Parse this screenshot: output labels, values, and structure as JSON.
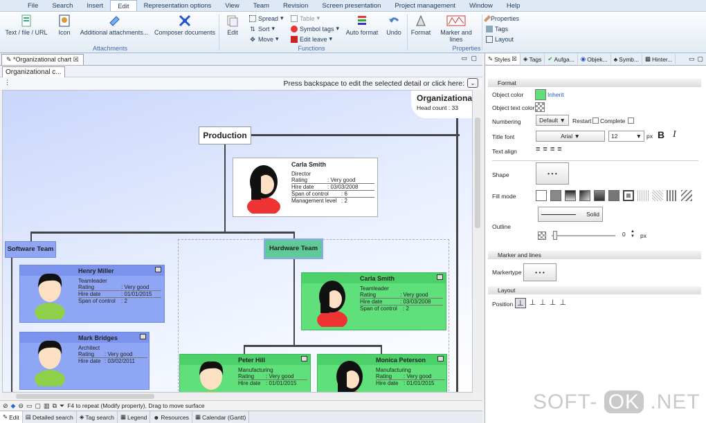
{
  "menu": [
    "File",
    "Search",
    "Insert",
    "Edit",
    "Representation options",
    "View",
    "Team",
    "Revision",
    "Screen presentation",
    "Project management",
    "Window",
    "Help"
  ],
  "ribbon": {
    "text_file_url": "Text / file / URL",
    "icon": "Icon",
    "additional": "Additional attachments...",
    "composer": "Composer documents",
    "attachments_group": "Attachments",
    "edit": "Edit",
    "spread": "Spread",
    "sort": "Sort",
    "move": "Move",
    "table": "Table",
    "symbol_tags": "Symbol tags",
    "edit_leave": "Edit leave",
    "auto_format": "Auto format",
    "undo": "Undo",
    "functions_group": "Functions",
    "format": "Format",
    "marker_lines": "Marker and lines",
    "properties": "Properties",
    "tags": "Tags",
    "layout": "Layout",
    "properties_group": "Properties"
  },
  "editor": {
    "tab": "*Organizational chart",
    "subtab": "Organizational c...",
    "hint": "Press backspace to edit the selected detail or click here:"
  },
  "chart": {
    "org_title": "Organizationa",
    "head_count": "Head count  : 33",
    "production": "Production",
    "software_team": "Software Team",
    "hardware_team": "Hardware Team",
    "carla_top": {
      "name": "Carla Smith",
      "role": "Director",
      "rating_l": "Rating",
      "rating": ": Very good",
      "hire_l": "Hire date",
      "hire": ": 03/03/2008",
      "span_l": "Span of control",
      "span": ": 6",
      "mgmt_l": "Management level",
      "mgmt": ": 2"
    },
    "henry": {
      "name": "Henry Miller",
      "role": "Teamleader",
      "rating_l": "Rating",
      "rating": ": Very good",
      "hire_l": "Hire date",
      "hire": ": 01/01/2015",
      "span_l": "Span of control",
      "span": ": 2"
    },
    "mark": {
      "name": "Mark Bridges",
      "role": "Architect",
      "rating_l": "Rating",
      "rating": ": Very good",
      "hire_l": "Hire date",
      "hire": ": 03/02/2011"
    },
    "carla_hw": {
      "name": "Carla Smith",
      "role": "Teamleader",
      "rating_l": "Rating",
      "rating": ": Very good",
      "hire_l": "Hire date",
      "hire": ": 03/03/2008",
      "span_l": "Span of control",
      "span": ": 2"
    },
    "peter": {
      "name": "Peter Hill",
      "role": "Manufacturing",
      "rating_l": "Rating",
      "rating": ": Very good",
      "hire_l": "Hire date",
      "hire": ": 01/01/2015"
    },
    "monica": {
      "name": "Monica Peterson",
      "role": "Manufacturing",
      "rating_l": "Rating",
      "rating": ": Very good",
      "hire_l": "Hire date",
      "hire": ": 01/01/2015"
    }
  },
  "status": "F4 to repeat (Modify property), Drag to move surface",
  "bottom_tabs": [
    "Edit",
    "Detailed search",
    "Tag search",
    "Legend",
    "Resources",
    "Calendar (Gantt)"
  ],
  "panel": {
    "tabs": [
      "Styles",
      "Tags",
      "Aufga...",
      "Objek...",
      "Symb...",
      "Hinter..."
    ],
    "format": "Format",
    "object_color": "Object color",
    "inherit": "Inherit",
    "object_text_color": "Object text color",
    "numbering": "Numbering",
    "default": "Default",
    "restart": "Restart",
    "complete": "Complete",
    "title_font": "Title font",
    "font": "Arial",
    "size": "12",
    "px": "px",
    "bold": "B",
    "italic": "I",
    "text_align": "Text align",
    "shape": "Shape",
    "fill_mode": "Fill mode",
    "solid": "Solid",
    "outline": "Outline",
    "outline_val": "0",
    "marker_section": "Marker and lines",
    "markertype": "Markertype",
    "layout_section": "Layout",
    "position": "Position"
  },
  "watermark": {
    "a": "SOFT-",
    "b": "OK",
    ".c": ".NET",
    "c": ".NET"
  },
  "colors": {
    "blue_card": "#8fa6f5",
    "green_card": "#5fe07a",
    "header_blue": "#7b93ec"
  }
}
